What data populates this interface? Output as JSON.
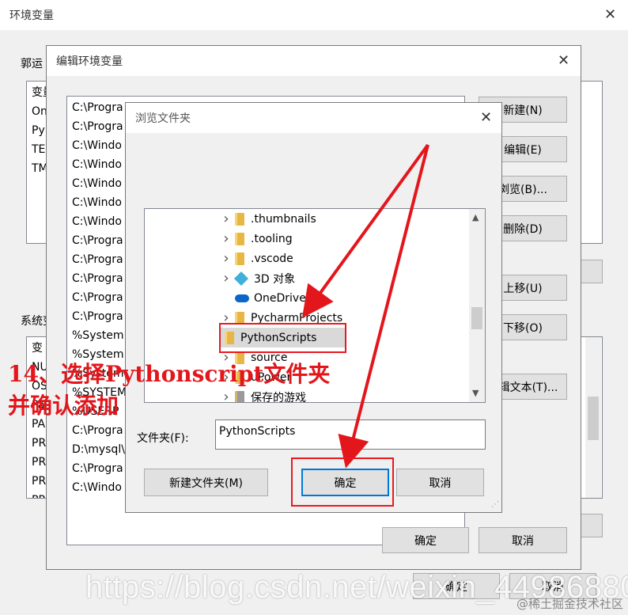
{
  "outer": {
    "title": "环境变量",
    "user_group": "郭运",
    "user_vars": [
      "变量",
      "On",
      "Py",
      "TE",
      "TM"
    ],
    "sys_group": "系统变",
    "sys_vars": [
      "变",
      "NU",
      "OS",
      "Pa",
      "PA",
      "PR",
      "PR",
      "PR",
      "PR"
    ],
    "ok": "确定",
    "cancel": "取消"
  },
  "edit": {
    "title": "编辑环境变量",
    "paths": [
      "C:\\Progra",
      "C:\\Progra",
      "C:\\Windo",
      "C:\\Windo",
      "C:\\Windo",
      "C:\\Windo",
      "C:\\Windo",
      "C:\\Progra",
      "C:\\Progra",
      "C:\\Progra",
      "C:\\Progra",
      "C:\\Progra",
      "%System",
      "%System",
      "%System",
      "%SYSTEM",
      "%USERP",
      "C:\\Progra",
      "D:\\mysql\\",
      "C:\\Progra",
      "C:\\Windo"
    ],
    "btn_new": "新建(N)",
    "btn_edit": "编辑(E)",
    "btn_browse": "浏览(B)...",
    "btn_delete": "删除(D)",
    "btn_up": "上移(U)",
    "btn_down": "下移(O)",
    "btn_edittext": "编辑文本(T)...",
    "ok": "确定",
    "cancel": "取消"
  },
  "browse": {
    "title": "浏览文件夹",
    "items": [
      {
        "label": ".thumbnails",
        "icon": "folder-icon",
        "chevron": true
      },
      {
        "label": ".tooling",
        "icon": "folder-icon",
        "chevron": true
      },
      {
        "label": ".vscode",
        "icon": "folder-icon",
        "chevron": true
      },
      {
        "label": "3D 对象",
        "icon": "3d-objects-icon",
        "chevron": true
      },
      {
        "label": "OneDrive",
        "icon": "onedrive-icon",
        "chevron": false
      },
      {
        "label": "PycharmProjects",
        "icon": "folder-icon",
        "chevron": true
      },
      {
        "label": "PythonScripts",
        "icon": "folder-icon",
        "chevron": false,
        "selected": true
      },
      {
        "label": "source",
        "icon": "folder-icon",
        "chevron": true
      },
      {
        "label": "uPower",
        "icon": "folder-icon",
        "chevron": true
      },
      {
        "label": "保存的游戏",
        "icon": "saved-games-icon",
        "chevron": true
      }
    ],
    "folder_label": "文件夹(F):",
    "folder_value": "PythonScripts",
    "new_folder": "新建文件夹(M)",
    "ok": "确定",
    "cancel": "取消"
  },
  "annotation": {
    "line1": "14、选择Pythonscript文件夹",
    "line2": "并确认添加",
    "color": "#e3161c"
  },
  "watermark": {
    "url": "https://blog.csdn.net/weixin_44986880",
    "brand": "@稀土掘金技术社区"
  }
}
